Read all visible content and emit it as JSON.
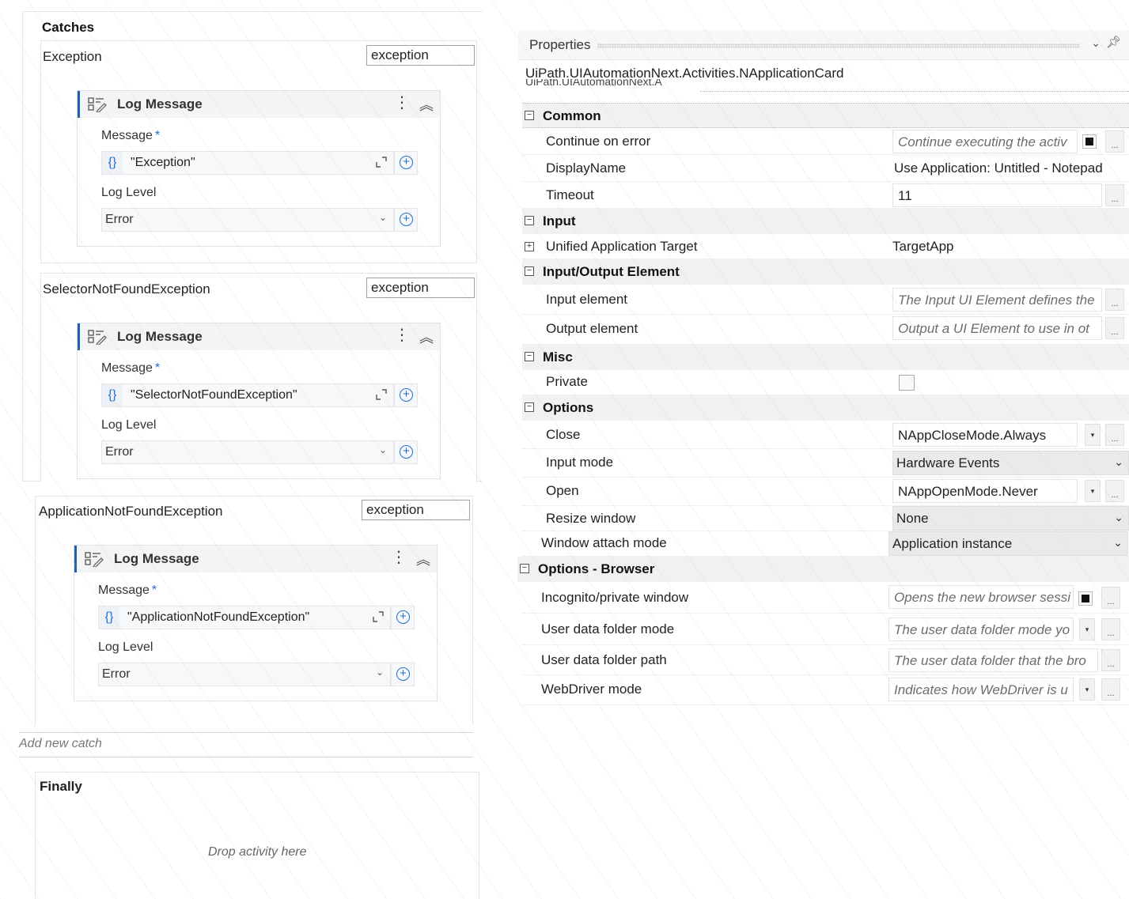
{
  "designer": {
    "catches_title": "Catches",
    "catches": [
      {
        "exception_type": "Exception",
        "variable": "exception",
        "activity": {
          "title": "Log Message",
          "message_label": "Message",
          "required_marker": "*",
          "message_value": "\"Exception\"",
          "log_level_label": "Log Level",
          "log_level_value": "Error"
        }
      },
      {
        "exception_type": "SelectorNotFoundException",
        "variable": "exception",
        "activity": {
          "title": "Log Message",
          "message_label": "Message",
          "required_marker": "*",
          "message_value": "\"SelectorNotFoundException\"",
          "log_level_label": "Log Level",
          "log_level_value": "Error"
        }
      },
      {
        "exception_type": "ApplicationNotFoundException",
        "variable": "exception",
        "activity": {
          "title": "Log Message",
          "message_label": "Message",
          "required_marker": "*",
          "message_value": "\"ApplicationNotFoundException\"",
          "log_level_label": "Log Level",
          "log_level_value": "Error"
        }
      }
    ],
    "add_new_catch": "Add new catch",
    "finally_title": "Finally",
    "drop_activity": "Drop activity here",
    "expression_icon": "{}",
    "accent_color": "#1f5fae"
  },
  "properties": {
    "title": "Properties",
    "type_name": "UiPath.UIAutomationNext.Activities.NApplicationCard",
    "type_name_ghost": "UiPath.UIAutomationNext.A",
    "categories": {
      "common": {
        "label": "Common",
        "continue_on_error": {
          "name": "Continue on error",
          "placeholder": "Continue executing the activ"
        },
        "display_name": {
          "name": "DisplayName",
          "value": "Use Application: Untitled - Notepad"
        },
        "timeout": {
          "name": "Timeout",
          "value": "11"
        }
      },
      "input": {
        "label": "Input",
        "unified_target": {
          "name": "Unified Application Target",
          "value": "TargetApp"
        }
      },
      "io_element": {
        "label": "Input/Output Element",
        "input_element": {
          "name": "Input element",
          "placeholder": "The Input UI Element defines the"
        },
        "output_element": {
          "name": "Output element",
          "placeholder": "Output a UI Element to use in ot"
        }
      },
      "misc": {
        "label": "Misc",
        "private": {
          "name": "Private",
          "checked": false
        }
      },
      "options": {
        "label": "Options",
        "close": {
          "name": "Close",
          "value": "NAppCloseMode.Always"
        },
        "input_mode": {
          "name": "Input mode",
          "value": "Hardware Events"
        },
        "open": {
          "name": "Open",
          "value": "NAppOpenMode.Never"
        },
        "resize_window": {
          "name": "Resize window",
          "value": "None"
        },
        "window_attach_mode": {
          "name": "Window attach mode",
          "value": "Application instance"
        }
      },
      "options_browser": {
        "label": "Options - Browser",
        "incognito": {
          "name": "Incognito/private window",
          "placeholder": "Opens the new browser sessi"
        },
        "user_data_folder_mode": {
          "name": "User data folder mode",
          "placeholder": "The user data folder mode yo"
        },
        "user_data_folder_path": {
          "name": "User data folder path",
          "placeholder": "The user data folder that the bro"
        },
        "webdriver_mode": {
          "name": "WebDriver mode",
          "placeholder": "Indicates how WebDriver is u"
        }
      }
    },
    "collapse_glyph": "−",
    "expand_glyph": "+",
    "ellipsis": "...",
    "dropdown_glyph": "▾",
    "chevron_glyph": "⌄",
    "pin_glyph": "⊥"
  }
}
